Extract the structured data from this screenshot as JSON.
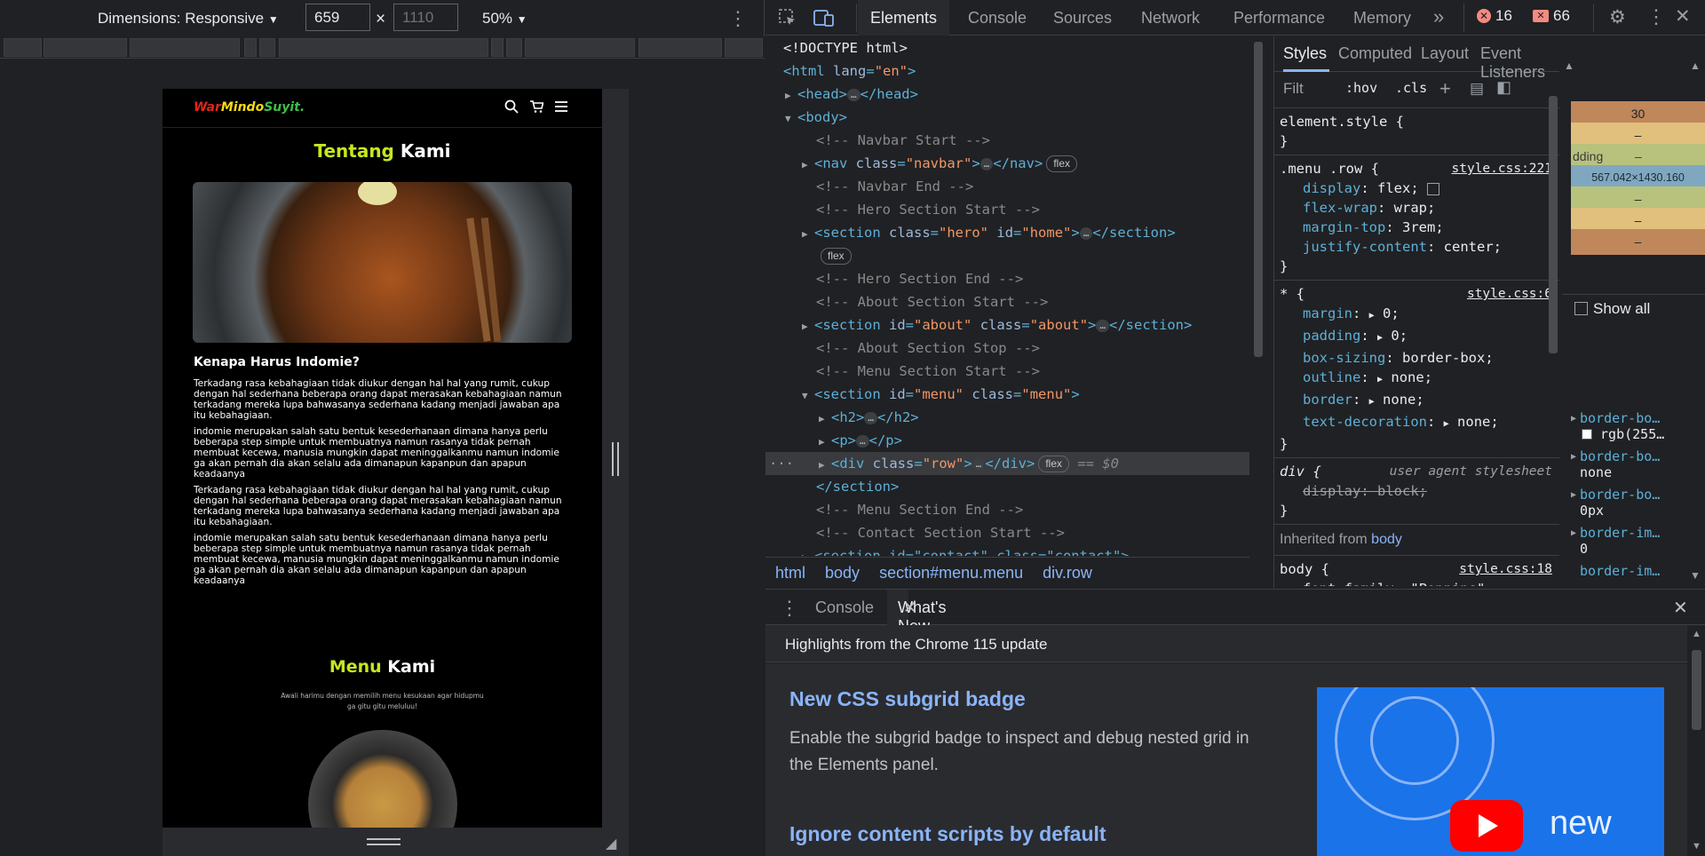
{
  "device_toolbar": {
    "dimensions_label": "Dimensions: Responsive",
    "width": "659",
    "height": "1110",
    "zoom": "50%"
  },
  "site": {
    "logo": {
      "part1": "War",
      "part2": "Mindo",
      "part3": "Suyit."
    },
    "about_title": {
      "a": "Tentang",
      "b": " Kami"
    },
    "why_heading": "Kenapa Harus Indomie?",
    "paragraphs": [
      "Terkadang rasa kebahagiaan tidak diukur dengan hal hal yang rumit, cukup dengan hal sederhana beberapa orang dapat merasakan kebahagiaan namun terkadang mereka lupa bahwasanya sederhana kadang menjadi jawaban apa itu kebahagiaan.",
      "indomie merupakan salah satu bentuk kesederhanaan dimana hanya perlu beberapa step simple untuk membuatnya namun rasanya tidak pernah membuat kecewa, manusia mungkin dapat meninggalkanmu namun indomie ga akan pernah dia akan selalu ada dimanapun kapanpun dan apapun keadaanya",
      "Terkadang rasa kebahagiaan tidak diukur dengan hal hal yang rumit, cukup dengan hal sederhana beberapa orang dapat merasakan kebahagiaan namun terkadang mereka lupa bahwasanya sederhana kadang menjadi jawaban apa itu kebahagiaan.",
      "indomie merupakan salah satu bentuk kesederhanaan dimana hanya perlu beberapa step simple untuk membuatnya namun rasanya tidak pernah membuat kecewa, manusia mungkin dapat meninggalkanmu namun indomie ga akan pernah dia akan selalu ada dimanapun kapanpun dan apapun keadaanya"
    ],
    "menu_title": {
      "a": "Menu",
      "b": " Kami"
    },
    "menu_sub": "Awali harimu dengan memilih menu kesukaan agar hidupmu ga gitu gitu meluluu!"
  },
  "devtools": {
    "tabs": [
      "Elements",
      "Console",
      "Sources",
      "Network",
      "Performance",
      "Memory"
    ],
    "active_tab": "Elements",
    "more": "»",
    "errors": "16",
    "warnings": "66"
  },
  "dom": {
    "doctype": "<!DOCTYPE html>",
    "html_open": "<html",
    "lang_attr": "lang",
    "lang_val": "\"en\"",
    "head_open": "<head>",
    "head_close": "</head>",
    "body_open": "<body>",
    "c_nav_start": "<!-- Navbar Start -->",
    "nav_open": "<nav",
    "nav_class_val": "\"navbar\"",
    "nav_close": "</nav>",
    "c_nav_end": "<!-- Navbar End -->",
    "c_hero_start": "<!-- Hero Section Start -->",
    "section_open": "<section",
    "hero_class_val": "\"hero\"",
    "hero_id_val": "\"home\"",
    "section_close": "</section>",
    "c_hero_end": "<!-- Hero Section End -->",
    "c_about_start": "<!-- About Section Start -->",
    "about_id_val": "\"about\"",
    "about_class_val": "\"about\"",
    "c_about_stop": "<!-- About Section Stop -->",
    "c_menu_start": "<!-- Menu Section Start -->",
    "menu_id_val": "\"menu\"",
    "menu_class_val": "\"menu\"",
    "h2_open": "<h2>",
    "h2_close": "</h2>",
    "p_open": "<p>",
    "p_close": "</p>",
    "div_open": "<div",
    "row_val": "\"row\"",
    "div_close": "</div>",
    "eq": "== $0",
    "c_menu_end": "<!-- Menu Section End -->",
    "c_contact_start": "<!-- Contact Section Start -->",
    "contact_line": "<section id=\"contact\" class=\"contact\">",
    "flex_badge": "flex",
    "ellipsis": "…",
    "attr_class": "class",
    "attr_id": "id"
  },
  "breadcrumbs": [
    "html",
    "body",
    "section#menu.menu",
    "div.row"
  ],
  "styles": {
    "tabs": [
      "Styles",
      "Computed",
      "Layout",
      "Event Listeners"
    ],
    "filter": "Filt",
    "hov": ":hov",
    "cls": ".cls",
    "element_style": "element.style {",
    "close_brace": "}",
    "r1_sel": ".menu .row {",
    "r1_src": "style.css:221",
    "r1_props": [
      [
        "display",
        "flex;"
      ],
      [
        "flex-wrap",
        "wrap;"
      ],
      [
        "margin-top",
        "3rem;"
      ],
      [
        "justify-content",
        "center;"
      ]
    ],
    "r2_sel": "* {",
    "r2_src": "style.css:6",
    "r2_props": [
      [
        "margin",
        "0;"
      ],
      [
        "padding",
        "0;"
      ],
      [
        "box-sizing",
        "border-box;"
      ],
      [
        "outline",
        "none;"
      ],
      [
        "border",
        "none;"
      ],
      [
        "text-decoration",
        "none;"
      ]
    ],
    "r3_sel": "div {",
    "r3_src": "user agent stylesheet",
    "r3_prop": "display: block;",
    "inherited_label": "Inherited from",
    "inherited_from": "body",
    "r4_sel": "body {",
    "r4_src": "style.css:18",
    "r4_cut": "font-family: \"Poppins\""
  },
  "boxmodel": {
    "margin": "30",
    "dash": "–",
    "padding_label": "dding",
    "content": "567.042×1430.160",
    "show_all": "Show all"
  },
  "computed": [
    {
      "name": "border-bo…",
      "value": "rgb(255…"
    },
    {
      "name": "border-bo…",
      "value": "none"
    },
    {
      "name": "border-bo…",
      "value": "0px"
    },
    {
      "name": "border-im…",
      "value": "0"
    },
    {
      "name": "border-im…",
      "value": ""
    }
  ],
  "drawer": {
    "tabs": [
      "Console",
      "What's New"
    ],
    "header": "Highlights from the Chrome 115 update",
    "item1_title": "New CSS subgrid badge",
    "item1_text": "Enable the subgrid badge to inspect and debug nested grid in the Elements panel.",
    "item2_title": "Ignore content scripts by default",
    "promo_text": "new"
  }
}
